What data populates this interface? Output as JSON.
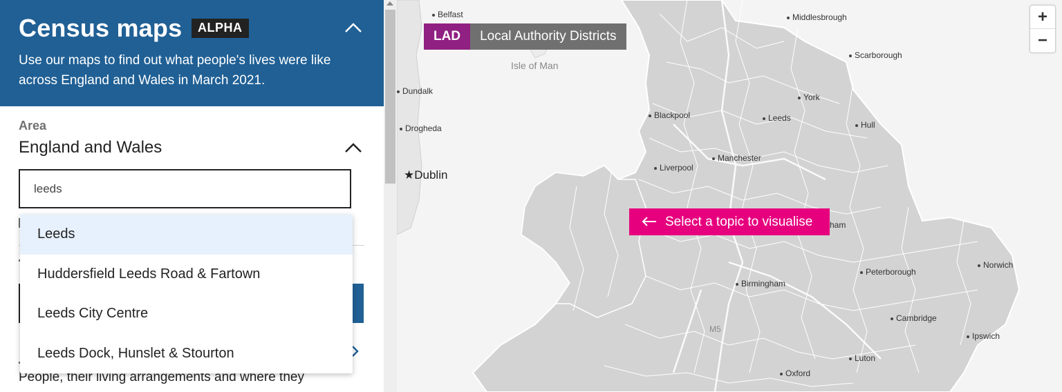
{
  "header": {
    "title": "Census maps",
    "badge": "ALPHA",
    "intro": "Use our maps to find out what people's lives were like across England and Wales in March 2021.",
    "collapse_icon": "chevron-up-icon"
  },
  "area": {
    "label": "Area",
    "value": "England and Wales",
    "toggle_icon": "chevron-up-icon"
  },
  "search": {
    "value": "leeds",
    "results": [
      {
        "label": "Leeds",
        "active": true
      },
      {
        "label": "Huddersfield Leeds Road & Fartown",
        "active": false
      },
      {
        "label": "Leeds City Centre",
        "active": false
      },
      {
        "label": "Leeds Dock, Hunslet & Stourton",
        "active": false
      }
    ]
  },
  "topics_text": "People, their living arrangements and where they",
  "map": {
    "geography_code": "LAD",
    "geography_name": "Local Authority Districts",
    "prompt": "Select a topic to visualise",
    "prompt_icon": "arrow-left-icon",
    "zoom_in": "+",
    "zoom_out": "−",
    "places": {
      "belfast": "Belfast",
      "middlesbrough": "Middlesbrough",
      "scarborough": "Scarborough",
      "isle_of_man": "Isle of Man",
      "dundalk": "Dundalk",
      "york": "York",
      "blackpool": "Blackpool",
      "leeds": "Leeds",
      "drogheda": "Drogheda",
      "hull": "Hull",
      "manchester": "Manchester",
      "liverpool": "Liverpool",
      "dublin": "Dublin",
      "ham_fragment": "ham",
      "norwich": "Norwich",
      "peterborough": "Peterborough",
      "birmingham": "Birmingham",
      "cambridge": "Cambridge",
      "ipswich": "Ipswich",
      "m5": "M5",
      "luton": "Luton",
      "oxford": "Oxford"
    }
  },
  "colors": {
    "header_bg": "#206095",
    "lad_badge": "#902082",
    "prompt_bg": "#e6007e",
    "map_land": "#d3d3d3"
  }
}
